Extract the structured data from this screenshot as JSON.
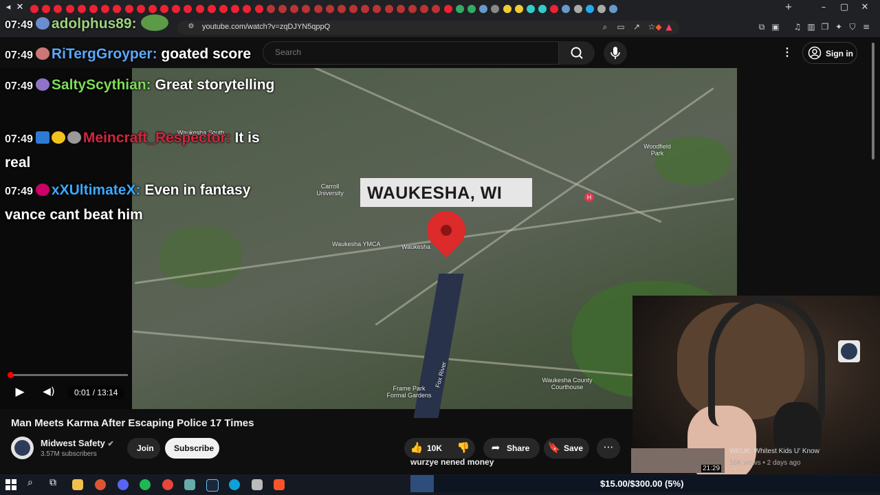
{
  "browser": {
    "url": "youtube.com/watch?v=zqDJYN5qppQ"
  },
  "youtube": {
    "search_placeholder": "Search",
    "sign_in": "Sign in",
    "video": {
      "overlay_title": "WAUKESHA, WI",
      "map_labels": [
        "Waukesha South",
        "Carroll University",
        "Woodfield Park",
        "Waukesha YMCA",
        "Waukesha",
        "Frame Park Formal Gardens",
        "Waukesha County Courthouse",
        "Fox River"
      ],
      "time": "0:01 / 13:14",
      "progress": 0.0013
    },
    "title": "Man Meets Karma After Escaping Police 17 Times",
    "channel": {
      "name": "Midwest Safety",
      "subscribers": "3.57M subscribers",
      "join": "Join",
      "subscribe": "Subscribe"
    },
    "actions": {
      "likes": "10K",
      "share": "Share",
      "save": "Save"
    },
    "recommended": {
      "title": "WKUK: Whitest Kids U' Know",
      "meta": "16K views • 2 days ago",
      "duration": "21:29"
    }
  },
  "chat": [
    {
      "time": "07:49",
      "user": "adolphus89:",
      "text": "",
      "color": "#9fd27e"
    },
    {
      "time": "07:49",
      "user": "RiTergGroyper:",
      "text": "goated score",
      "color": "#5aa9ff"
    },
    {
      "time": "07:49",
      "user": "SaltyScythian:",
      "text": "Great storytelling",
      "color": "#7ddc57"
    },
    {
      "time": "07:49",
      "user": "Meincraft_Respector:",
      "text": "It is real",
      "color": "#d4253f"
    },
    {
      "time": "07:49",
      "user": "xXUltimateX:",
      "text": "Even in fantasy vance cant beat him",
      "color": "#3ba9ff"
    }
  ],
  "stream_caption": "wurzye nened money",
  "donation_goal": {
    "text": "$15.00/$300.00 (5%)",
    "fraction": 0.05
  }
}
